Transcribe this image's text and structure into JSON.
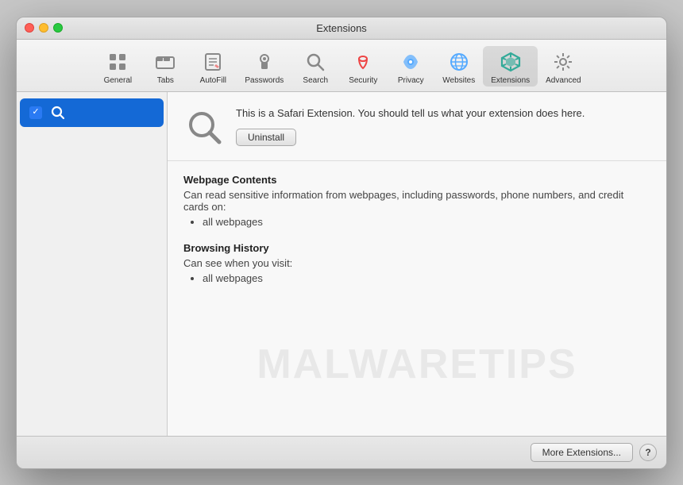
{
  "window": {
    "title": "Extensions"
  },
  "titlebar": {
    "buttons": {
      "close": "close",
      "minimize": "minimize",
      "maximize": "maximize"
    },
    "title": "Extensions"
  },
  "toolbar": {
    "items": [
      {
        "id": "general",
        "label": "General",
        "icon": "general-icon"
      },
      {
        "id": "tabs",
        "label": "Tabs",
        "icon": "tabs-icon"
      },
      {
        "id": "autofill",
        "label": "AutoFill",
        "icon": "autofill-icon"
      },
      {
        "id": "passwords",
        "label": "Passwords",
        "icon": "passwords-icon"
      },
      {
        "id": "search",
        "label": "Search",
        "icon": "search-icon"
      },
      {
        "id": "security",
        "label": "Security",
        "icon": "security-icon"
      },
      {
        "id": "privacy",
        "label": "Privacy",
        "icon": "privacy-icon"
      },
      {
        "id": "websites",
        "label": "Websites",
        "icon": "websites-icon"
      },
      {
        "id": "extensions",
        "label": "Extensions",
        "icon": "extensions-icon",
        "active": true
      },
      {
        "id": "advanced",
        "label": "Advanced",
        "icon": "advanced-icon"
      }
    ]
  },
  "sidebar": {
    "items": [
      {
        "id": "search-ext",
        "label": "",
        "checked": true,
        "selected": true
      }
    ]
  },
  "main": {
    "ext_description": "This is a Safari Extension. You should tell us what your extension does here.",
    "uninstall_label": "Uninstall",
    "permissions": [
      {
        "title": "Webpage Contents",
        "description": "Can read sensitive information from webpages, including passwords, phone numbers, and credit cards on:",
        "items": [
          "all webpages"
        ]
      },
      {
        "title": "Browsing History",
        "description": "Can see when you visit:",
        "items": [
          "all webpages"
        ]
      }
    ]
  },
  "footer": {
    "more_extensions_label": "More Extensions...",
    "help_label": "?"
  },
  "watermark": {
    "text": "MALWARETIPS"
  }
}
